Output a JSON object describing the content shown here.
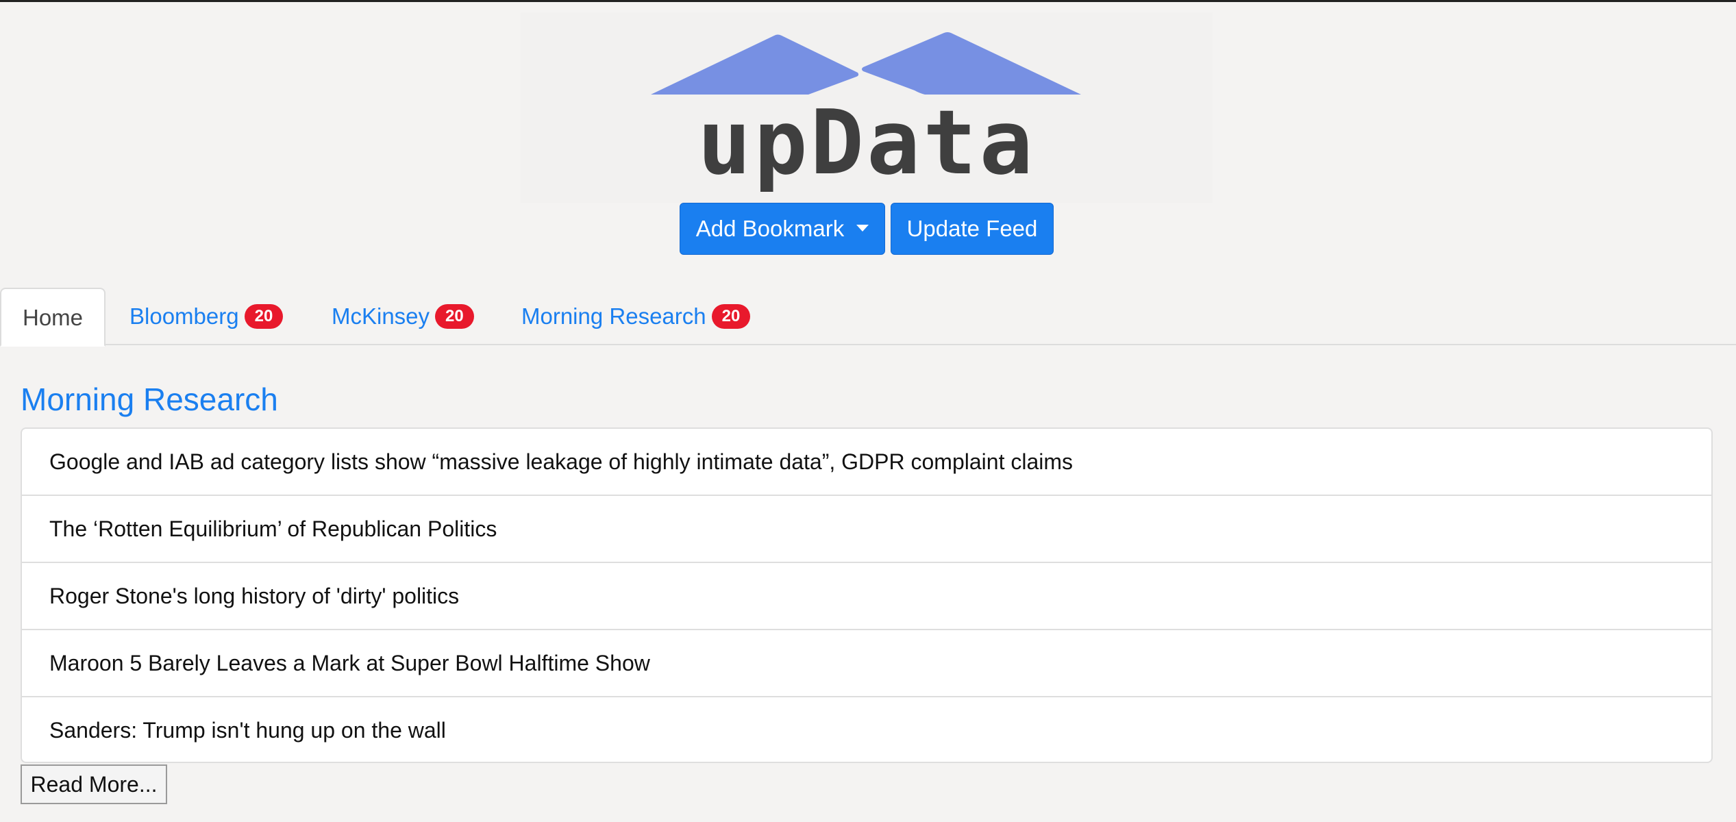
{
  "brand": {
    "logo_text": "upData",
    "logo_color": "#7790e3",
    "text_color": "#3f3f3f"
  },
  "actions": {
    "add_bookmark_label": "Add Bookmark",
    "update_feed_label": "Update Feed",
    "accent_color": "#1a7ff0"
  },
  "tabs": [
    {
      "label": "Home",
      "active": true
    },
    {
      "label": "Bloomberg",
      "badge": "20"
    },
    {
      "label": "McKinsey",
      "badge": "20"
    },
    {
      "label": "Morning Research",
      "badge": "20"
    }
  ],
  "badge_color": "#e8192c",
  "section": {
    "title": "Morning Research",
    "items": [
      "Google and IAB ad category lists show “massive leakage of highly intimate data”, GDPR complaint claims",
      "The ‘Rotten Equilibrium’ of Republican Politics",
      "Roger Stone's long history of 'dirty' politics",
      "Maroon 5 Barely Leaves a Mark at Super Bowl Halftime Show",
      "Sanders: Trump isn't hung up on the wall"
    ],
    "read_more_label": "Read More..."
  }
}
